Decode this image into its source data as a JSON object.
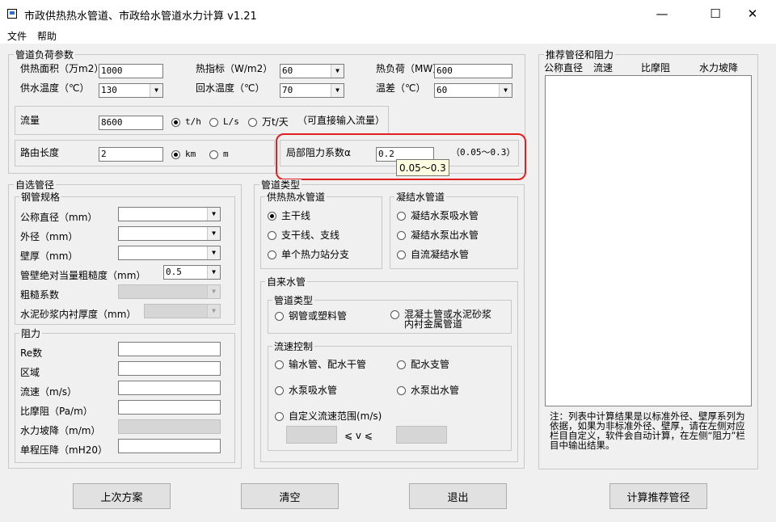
{
  "window": {
    "title": "市政供热热水管道、市政给水管道水力计算 v1.21",
    "minimize": "—",
    "maximize": "☐",
    "close": "✕"
  },
  "menu": {
    "file": "文件",
    "help": "帮助"
  },
  "load": {
    "title": "管道负荷参数",
    "area_label": "供热面积（万m2）",
    "area_value": "1000",
    "index_label": "热指标（W/m2）",
    "index_value": "60",
    "heat_label": "热负荷（MW）",
    "heat_value": "600",
    "supply_label": "供水温度（℃）",
    "supply_value": "130",
    "return_label": "回水温度（℃）",
    "return_value": "70",
    "diff_label": "温差（℃）",
    "diff_value": "60"
  },
  "flow": {
    "label": "流量",
    "value": "8600",
    "unit_th": "t/h",
    "unit_ls": "L/s",
    "unit_wtd": "万t/天",
    "note": "（可直接输入流量）"
  },
  "route": {
    "label": "路由长度",
    "value": "2",
    "unit_km": "km",
    "unit_m": "m"
  },
  "local": {
    "label": "局部阻力系数α",
    "value": "0.2",
    "range": "（0.05～0.3）",
    "tooltip": "0.05～0.3"
  },
  "custom": {
    "title": "自选管径",
    "steel_title": "钢管规格",
    "dn_label": "公称直径（mm）",
    "od_label": "外径（mm）",
    "wall_label": "壁厚（mm）",
    "rough_label": "管壁绝对当量粗糙度（mm）",
    "rough_value": "0.5",
    "coef_label": "粗糙系数",
    "mortar_label": "水泥砂浆内衬厚度（mm）"
  },
  "resist": {
    "title": "阻力",
    "re_label": "Re数",
    "zone_label": "区域",
    "vel_label": "流速（m/s）",
    "fric_label": "比摩阻（Pa/m）",
    "slope_label": "水力坡降（m/m）",
    "drop_label": "单程压降（mH20）"
  },
  "pipetype": {
    "title": "管道类型",
    "heat_title": "供热热水管道",
    "main": "主干线",
    "branch": "支干线、支线",
    "single": "单个热力站分支",
    "cond_title": "凝结水管道",
    "cond_pump_in": "凝结水泵吸水管",
    "cond_pump_out": "凝结水泵出水管",
    "cond_gravity": "自流凝结水管",
    "tap_title": "自来水管",
    "tap_type_title": "管道类型",
    "steel_plastic": "钢管或塑料管",
    "concrete_line1": "混凝土管或水泥砂浆",
    "concrete_line2": "内衬金属管道",
    "speed_title": "流速控制",
    "trunk": "输水管、配水干管",
    "dist_branch": "配水支管",
    "pump_suction": "水泵吸水管",
    "pump_out": "水泵出水管",
    "custom_range": "自定义流速范围(m/s)",
    "le_v_le": "⩽ v ⩽"
  },
  "recommend": {
    "title": "推荐管径和阻力",
    "col_dn": "公称直径",
    "col_vel": "流速",
    "col_fric": "比摩阻",
    "col_slope": "水力坡降",
    "note": "注：列表中计算结果是以标准外径、壁厚系列为依据，如果为非标准外径、壁厚，请在左侧对应栏目自定义，软件会自动计算，在左侧“阻力”栏目中输出结果。"
  },
  "buttons": {
    "prev": "上次方案",
    "clear": "清空",
    "exit": "退出",
    "calc": "计算推荐管径"
  }
}
